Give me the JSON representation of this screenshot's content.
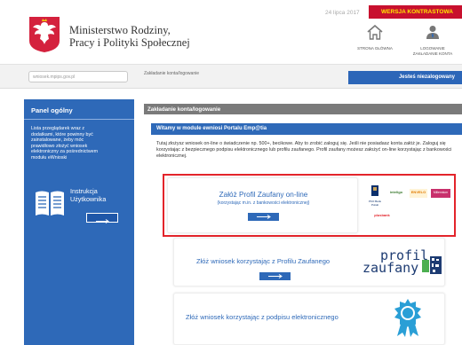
{
  "header": {
    "ministry_line1": "Ministerstwo Rodziny,",
    "ministry_line2": "Pracy i Polityki Społecznej",
    "date": "24 lipca 2017",
    "contrast_label": "WERSJA KONTRASTOWA",
    "home_label": "STRONA GŁÓWNA",
    "login_label_line1": "LOGOWANIE",
    "login_label_line2": "ZAKŁADANIE KONTA"
  },
  "search": {
    "placeholder": "wniosek.mpips.gov.pl"
  },
  "breadcrumb": "Zakładanie konta/logowanie",
  "status": "Jesteś niezalogowany",
  "sidebar": {
    "panel_title": "Panel ogólny",
    "info_text": "Lista przeglądarek wraz z dodatkami, które powinny być zainstalowane, żeby móc prawidłowo złożyć wniosek elektroniczny za pośrednictwem modułu eWnioski",
    "manual_line1": "Instrukcja",
    "manual_line2": "Użytkownika"
  },
  "main": {
    "section_title": "Zakładanie konta/logowanie",
    "welcome": "Witamy w module ewniosi Portalu Emp@tia",
    "intro": "Tutaj złożysz wniosek on-line o świadczenie np. 500+, becikowe. Aby to zrobić zaloguj się. Jeśli nie posiadasz konta załóż je. Zaloguj się korzystając z bezpiecznego podpisu elektronicznego lub profilu zaufanego. Profil zaufany możesz założyć on-line korzystając z bankowości elektronicznej.",
    "card1_title": "Załóż Profil Zaufany on-line",
    "card1_sub": "(korzystając m.in. z bankowości elektronicznej)",
    "card2_title": "Złóż wniosek korzystając z Profilu Zaufanego",
    "card2_logo_line1": "profil",
    "card2_logo_line2": "zaufany",
    "card3_title": "Złóż wniosek korzystając z podpisu elektronicznego"
  },
  "bank_logos": [
    "PKO Bank Polski",
    "inteligo",
    "ENVELO",
    "Millennium",
    "plusbank"
  ],
  "colors": {
    "accent_blue": "#2e69b8",
    "highlight_red": "#e3242b",
    "contrast_red": "#c8102e",
    "contrast_text": "#ffe600"
  }
}
